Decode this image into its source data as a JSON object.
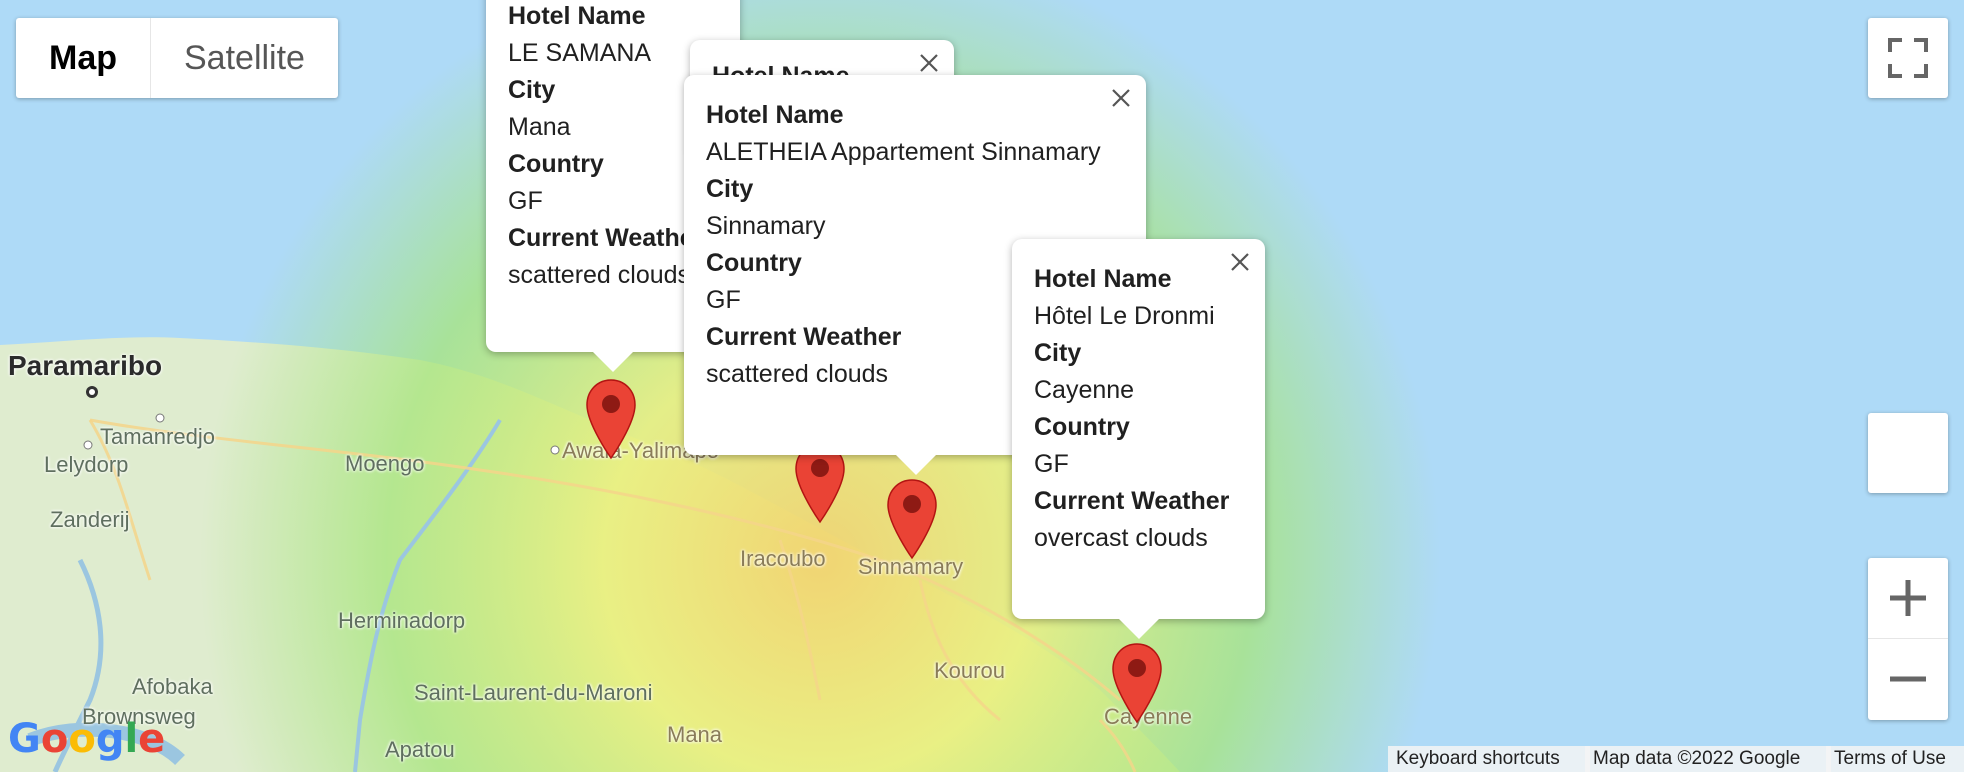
{
  "map_type": {
    "map_label": "Map",
    "satellite_label": "Satellite",
    "selected": "Map"
  },
  "places": {
    "paramaribo": "Paramaribo",
    "tamanredjo": "Tamanredjo",
    "lelydorp": "Lelydorp",
    "zanderij": "Zanderij",
    "moengo": "Moengo",
    "awala": "Awala-Yalimapo",
    "iracoubo": "Iracoubo",
    "sinnamary": "Sinnamary",
    "kourou": "Kourou",
    "herminadorp": "Herminadorp",
    "saint_laurent": "Saint-Laurent-du-Maroni",
    "afobaka": "Afobaka",
    "brownsweg": "Brownsweg",
    "mana": "Mana",
    "apatou": "Apatou",
    "cayenne": "Cayenne"
  },
  "info_windows": [
    {
      "hotel_label": "Hotel Name",
      "hotel": "LE SAMANA",
      "city_label": "City",
      "city": "Mana",
      "country_label": "Country",
      "country": "GF",
      "weather_label": "Current Weather",
      "weather": "scattered clouds"
    },
    {
      "hotel_label": "Hotel Name",
      "hotel": "",
      "city_label": "",
      "city": "",
      "country_label": "",
      "country": "",
      "weather_label": "",
      "weather": ""
    },
    {
      "hotel_label": "Hotel Name",
      "hotel": "ALETHEIA Appartement Sinnamary",
      "city_label": "City",
      "city": "Sinnamary",
      "country_label": "Country",
      "country": "GF",
      "weather_label": "Current Weather",
      "weather": "scattered clouds"
    },
    {
      "hotel_label": "Hotel Name",
      "hotel": "Hôtel Le Dronmi",
      "city_label": "City",
      "city": "Cayenne",
      "country_label": "Country",
      "country": "GF",
      "weather_label": "Current Weather",
      "weather": "overcast clouds"
    }
  ],
  "footer": {
    "shortcuts": "Keyboard shortcuts",
    "map_data": "Map data ©2022 Google",
    "terms": "Terms of Use"
  },
  "logo": "Google",
  "colors": {
    "water": "#aedaf7",
    "land": "#dfeccf",
    "marker": "#ea4335"
  },
  "icons": {
    "fullscreen": "fullscreen-icon",
    "zoom_in": "plus-icon",
    "zoom_out": "minus-icon",
    "close": "close-icon",
    "marker": "map-pin-icon"
  }
}
